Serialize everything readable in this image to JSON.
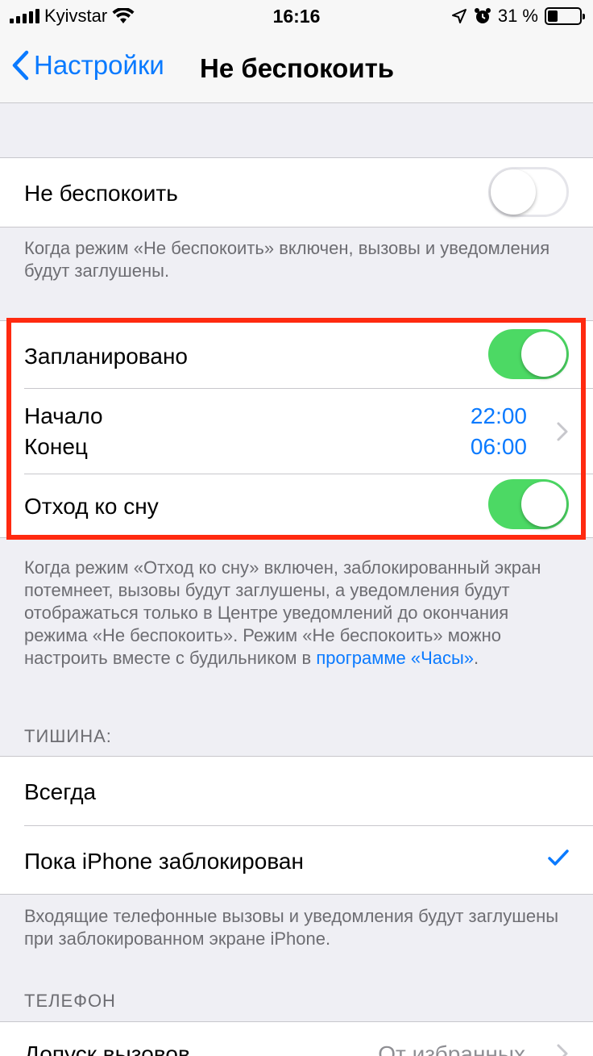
{
  "status": {
    "carrier": "Kyivstar",
    "time": "16:16",
    "battery": "31 %",
    "battery_level": 0.31
  },
  "nav": {
    "back_label": "Настройки",
    "title": "Не беспокоить"
  },
  "dnd": {
    "label": "Не беспокоить",
    "enabled": false,
    "footer": "Когда режим «Не беспокоить» включен, вызовы и уведомления будут заглушены."
  },
  "schedule": {
    "scheduled_label": "Запланировано",
    "scheduled_on": true,
    "start_label": "Начало",
    "start_time": "22:00",
    "end_label": "Конец",
    "end_time": "06:00",
    "bedtime_label": "Отход ко сну",
    "bedtime_on": true
  },
  "bedtime_footer": {
    "text": "Когда режим «Отход ко сну» включен, заблокированный экран потемнеет, вызовы будут заглушены, а уведомления будут отображаться только в Центре уведомлений до окончания режима «Не беспокоить». Режим «Не беспокоить» можно настроить вместе с будильником в ",
    "link": "программе «Часы»",
    "suffix": "."
  },
  "silence": {
    "header": "ТИШИНА:",
    "always_label": "Всегда",
    "locked_label": "Пока iPhone заблокирован",
    "footer": "Входящие телефонные вызовы и уведомления будут заглушены при заблокированном экране iPhone."
  },
  "phone": {
    "header": "ТЕЛЕФОН",
    "allow_calls_label": "Допуск вызовов",
    "allow_calls_value": "От избранных"
  },
  "colors": {
    "accent": "#0a7aff",
    "toggle_on": "#4cd964",
    "highlight": "#ff2a10"
  }
}
